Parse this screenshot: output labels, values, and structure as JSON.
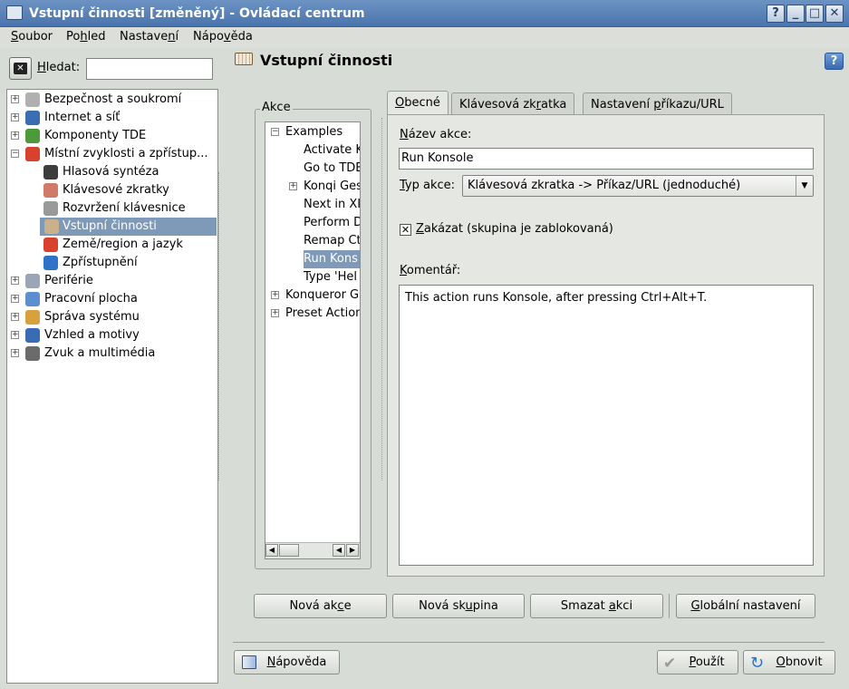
{
  "window": {
    "title": "Vstupní činnosti [změněný] - Ovládací centrum",
    "controls": [
      "?",
      "_",
      "□",
      "✕"
    ]
  },
  "menubar": {
    "items": [
      {
        "pre": "",
        "u": "S",
        "post": "oubor"
      },
      {
        "pre": "Po",
        "u": "h",
        "post": "led"
      },
      {
        "pre": "Nastave",
        "u": "n",
        "post": "í"
      },
      {
        "pre": "Nápo",
        "u": "v",
        "post": "ěda"
      }
    ]
  },
  "search": {
    "label_u": "H",
    "label_rest": "ledat:",
    "value": ""
  },
  "sidebar": {
    "items": [
      {
        "label": "Bezpečnost a soukromí",
        "level": 0,
        "expander": "+",
        "color": "#b0b0b0"
      },
      {
        "label": "Internet a síť",
        "level": 0,
        "expander": "+",
        "color": "#3b6db3"
      },
      {
        "label": "Komponenty TDE",
        "level": 0,
        "expander": "+",
        "color": "#4c9a3a"
      },
      {
        "label": "Místní zvyklosti a zpřístup...",
        "level": 0,
        "expander": "−",
        "color": "#d9412f"
      },
      {
        "label": "Hlasová syntéza",
        "level": 1,
        "expander": "",
        "color": "#3d3d3d"
      },
      {
        "label": "Klávesové zkratky",
        "level": 1,
        "expander": "",
        "color": "#d07a6a"
      },
      {
        "label": "Rozvržení klávesnice",
        "level": 1,
        "expander": "",
        "color": "#9a9a9a"
      },
      {
        "label": "Vstupní činnosti",
        "level": 1,
        "expander": "",
        "color": "#c9b18a",
        "selected": true
      },
      {
        "label": "Země/region a jazyk",
        "level": 1,
        "expander": "",
        "color": "#d9412f"
      },
      {
        "label": "Zpřístupnění",
        "level": 1,
        "expander": "",
        "color": "#2f73c9"
      },
      {
        "label": "Periférie",
        "level": 0,
        "expander": "+",
        "color": "#9aa6b5"
      },
      {
        "label": "Pracovní plocha",
        "level": 0,
        "expander": "+",
        "color": "#5b8fd0"
      },
      {
        "label": "Správa systému",
        "level": 0,
        "expander": "+",
        "color": "#d7a23b"
      },
      {
        "label": "Vzhled a motivy",
        "level": 0,
        "expander": "+",
        "color": "#3a6cb5"
      },
      {
        "label": "Zvuk a multimédia",
        "level": 0,
        "expander": "+",
        "color": "#6b6b6b"
      }
    ]
  },
  "main": {
    "title": "Vstupní činnosti",
    "help": "?"
  },
  "akce": {
    "legend": "Akce",
    "items": [
      {
        "label": "Examples",
        "level": 0,
        "expander": "−"
      },
      {
        "label": "Activate K",
        "level": 1,
        "expander": ""
      },
      {
        "label": "Go to TDE",
        "level": 1,
        "expander": ""
      },
      {
        "label": "Konqi Ges",
        "level": 1,
        "expander": "+"
      },
      {
        "label": "Next in XI",
        "level": 1,
        "expander": ""
      },
      {
        "label": "Perform D",
        "level": 1,
        "expander": ""
      },
      {
        "label": "Remap Ct",
        "level": 1,
        "expander": ""
      },
      {
        "label": "Run Kons",
        "level": 1,
        "expander": "",
        "selected": true
      },
      {
        "label": "Type 'Hel",
        "level": 1,
        "expander": ""
      },
      {
        "label": "Konqueror G",
        "level": 0,
        "expander": "+"
      },
      {
        "label": "Preset Action",
        "level": 0,
        "expander": "+"
      }
    ]
  },
  "tabs": [
    {
      "pre": "",
      "u": "O",
      "post": "becné",
      "active": true
    },
    {
      "pre": "Klávesová zk",
      "u": "r",
      "post": "atka",
      "active": false
    },
    {
      "pre": "Nastavení ",
      "u": "p",
      "post": "říkazu/URL",
      "active": false
    }
  ],
  "form": {
    "name_label_u": "N",
    "name_label_rest": "ázev akce:",
    "name_value": "Run Konsole",
    "type_label_u": "T",
    "type_label_rest": "yp akce:",
    "type_value": "Klávesová zkratka -> Příkaz/URL (jednoduché)",
    "disable_u": "Z",
    "disable_rest": "akázat (skupina je zablokovaná)",
    "disable_checked": "✕",
    "comment_label_u": "K",
    "comment_label_rest": "omentář:",
    "comment_value": "This action runs Konsole, after pressing Ctrl+Alt+T."
  },
  "buttons": {
    "new_action": {
      "pre": "Nová ak",
      "u": "c",
      "post": "e"
    },
    "new_group": {
      "pre": "Nová sk",
      "u": "u",
      "post": "pina"
    },
    "delete": {
      "pre": "Smazat ",
      "u": "a",
      "post": "kci"
    },
    "global": {
      "pre": "",
      "u": "G",
      "post": "lobální nastavení"
    },
    "help": {
      "pre": "",
      "u": "N",
      "post": "ápověda"
    },
    "apply": {
      "pre": "",
      "u": "P",
      "post": "oužít"
    },
    "reset": {
      "pre": "",
      "u": "O",
      "post": "bnovit"
    }
  }
}
